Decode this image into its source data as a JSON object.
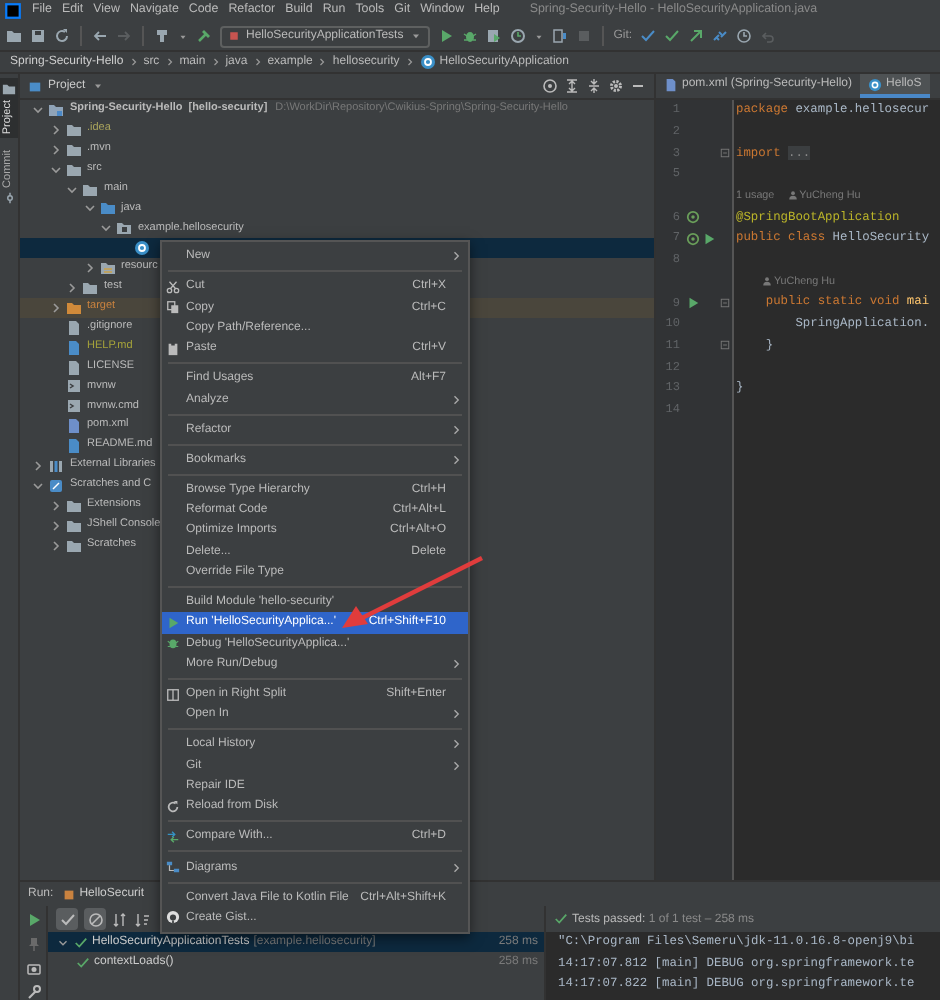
{
  "menu_bar": {
    "items": [
      "File",
      "Edit",
      "View",
      "Navigate",
      "Code",
      "Refactor",
      "Build",
      "Run",
      "Tools",
      "Git",
      "Window",
      "Help"
    ],
    "title": "Spring-Security-Hello - HelloSecurityApplication.java"
  },
  "toolbar": {
    "run_config": "HelloSecurityApplicationTests",
    "git_label": "Git:"
  },
  "breadcrumb": [
    "Spring-Security-Hello",
    "src",
    "main",
    "java",
    "example",
    "hellosecurity",
    "HelloSecurityApplication"
  ],
  "side_tabs": [
    {
      "label": "Project",
      "selected": true
    },
    {
      "label": "Commit",
      "selected": false
    }
  ],
  "project_panel": {
    "title": "Project",
    "tree": [
      {
        "label": "Spring-Security-Hello",
        "suffix": "[hello-security]",
        "path": "D:\\WorkDir\\Repository\\Cwikius-Spring\\Spring-Security-Hello",
        "kind": "module",
        "expanded": true,
        "selected": false,
        "children": [
          {
            "label": ".idea",
            "kind": "folder",
            "expanded": false,
            "selected": false,
            "color": "#a8a25c"
          },
          {
            "label": ".mvn",
            "kind": "folder",
            "expanded": false,
            "selected": false
          },
          {
            "label": "src",
            "kind": "folder",
            "expanded": true,
            "selected": false,
            "children": [
              {
                "label": "main",
                "kind": "folder",
                "expanded": true,
                "selected": false,
                "children": [
                  {
                    "label": "java",
                    "kind": "source",
                    "expanded": true,
                    "selected": false,
                    "children": [
                      {
                        "label": "example.hellosecurity",
                        "kind": "package",
                        "expanded": true,
                        "selected": false,
                        "children": [
                          {
                            "kind": "class",
                            "selected": true
                          }
                        ]
                      }
                    ]
                  },
                  {
                    "label": "resourc",
                    "kind": "resources",
                    "expanded": false,
                    "selected": false
                  }
                ]
              },
              {
                "label": "test",
                "kind": "folder",
                "expanded": false,
                "selected": false
              }
            ]
          },
          {
            "label": "target",
            "kind": "excluded",
            "expanded": false,
            "selected": false,
            "color": "#c9823f"
          },
          {
            "label": ".gitignore",
            "kind": "file",
            "selected": false
          },
          {
            "label": "HELP.md",
            "kind": "markdown",
            "selected": false,
            "color": "#a6a33a"
          },
          {
            "label": "LICENSE",
            "kind": "file",
            "selected": false
          },
          {
            "label": "mvnw",
            "kind": "script",
            "selected": false
          },
          {
            "label": "mvnw.cmd",
            "kind": "script",
            "selected": false
          },
          {
            "label": "pom.xml",
            "kind": "maven",
            "selected": false
          },
          {
            "label": "README.md",
            "kind": "markdown",
            "selected": false
          }
        ]
      },
      {
        "label": "External Libraries",
        "kind": "libraries",
        "expanded": false,
        "selected": false
      },
      {
        "label": "Scratches and C",
        "kind": "scratches",
        "expanded": true,
        "selected": false,
        "children": [
          {
            "label": "Extensions",
            "kind": "folder",
            "expanded": false,
            "selected": false
          },
          {
            "label": "JShell Console",
            "kind": "folder",
            "expanded": false,
            "selected": false
          },
          {
            "label": "Scratches",
            "kind": "folder",
            "expanded": false,
            "selected": false
          }
        ]
      }
    ]
  },
  "editor": {
    "tabs": [
      {
        "label": "pom.xml (Spring-Security-Hello)",
        "kind": "maven",
        "selected": false
      },
      {
        "label": "HelloS",
        "kind": "class",
        "selected": true
      }
    ],
    "lines": [
      {
        "number": "1",
        "tokens": [
          {
            "text": "package",
            "kind": "keyword"
          },
          {
            "text": " example.hellosecur",
            "kind": "plain"
          }
        ]
      },
      {
        "number": "2"
      },
      {
        "number": "3",
        "fold": true,
        "tokens": [
          {
            "text": "import ",
            "kind": "keyword"
          },
          {
            "text": "...",
            "kind": "folded"
          }
        ]
      },
      {
        "number": "5"
      },
      {
        "kind": "hint",
        "usages": "1 usage",
        "author": "YuCheng Hu"
      },
      {
        "number": "6",
        "bean": true,
        "tokens": [
          {
            "text": "@SpringBootApplication",
            "kind": "annotation"
          }
        ]
      },
      {
        "number": "7",
        "bean": true,
        "runnable": true,
        "tokens": [
          {
            "text": "public class",
            "kind": "keyword"
          },
          {
            "text": " HelloSecurity",
            "kind": "plain"
          }
        ]
      },
      {
        "number": "8"
      },
      {
        "kind": "hint",
        "author": "YuCheng Hu"
      },
      {
        "number": "9",
        "runnable": true,
        "fold": true,
        "tokens": [
          {
            "text": "    public static void",
            "kind": "keyword"
          },
          {
            "text": " mai",
            "kind": "method"
          }
        ]
      },
      {
        "number": "10",
        "tokens": [
          {
            "text": "        SpringApplication.",
            "kind": "plain"
          }
        ]
      },
      {
        "number": "11",
        "fold": true,
        "tokens": [
          {
            "text": "    }",
            "kind": "plain"
          }
        ]
      },
      {
        "number": "12"
      },
      {
        "number": "13",
        "tokens": [
          {
            "text": "}",
            "kind": "plain"
          }
        ]
      },
      {
        "number": "14"
      }
    ]
  },
  "context_menu": {
    "groups": [
      [
        {
          "label": "New",
          "submenu": true,
          "selected": false
        }
      ],
      [
        {
          "label": "Cut",
          "shortcut": "Ctrl+X",
          "submenu": false,
          "selected": false
        },
        {
          "label": "Copy",
          "shortcut": "Ctrl+C",
          "submenu": false,
          "selected": false
        },
        {
          "label": "Copy Path/Reference...",
          "submenu": false,
          "selected": false
        },
        {
          "label": "Paste",
          "shortcut": "Ctrl+V",
          "submenu": false,
          "selected": false
        }
      ],
      [
        {
          "label": "Find Usages",
          "shortcut": "Alt+F7",
          "submenu": false,
          "selected": false
        },
        {
          "label": "Analyze",
          "submenu": true,
          "selected": false
        }
      ],
      [
        {
          "label": "Refactor",
          "submenu": true,
          "selected": false
        }
      ],
      [
        {
          "label": "Bookmarks",
          "submenu": true,
          "selected": false
        }
      ],
      [
        {
          "label": "Browse Type Hierarchy",
          "shortcut": "Ctrl+H",
          "submenu": false,
          "selected": false
        },
        {
          "label": "Reformat Code",
          "shortcut": "Ctrl+Alt+L",
          "submenu": false,
          "selected": false
        },
        {
          "label": "Optimize Imports",
          "shortcut": "Ctrl+Alt+O",
          "submenu": false,
          "selected": false
        },
        {
          "label": "Delete...",
          "shortcut": "Delete",
          "submenu": false,
          "selected": false
        },
        {
          "label": "Override File Type",
          "submenu": false,
          "selected": false
        }
      ],
      [
        {
          "label": "Build Module 'hello-security'",
          "submenu": false,
          "selected": false
        },
        {
          "label": "Run 'HelloSecurityApplica...'",
          "shortcut": "Ctrl+Shift+F10",
          "submenu": false,
          "selected": true
        },
        {
          "label": "Debug 'HelloSecurityApplica...'",
          "submenu": false,
          "selected": false
        },
        {
          "label": "More Run/Debug",
          "submenu": true,
          "selected": false
        }
      ],
      [
        {
          "label": "Open in Right Split",
          "shortcut": "Shift+Enter",
          "submenu": false,
          "selected": false
        },
        {
          "label": "Open In",
          "submenu": true,
          "selected": false
        }
      ],
      [
        {
          "label": "Local History",
          "submenu": true,
          "selected": false
        },
        {
          "label": "Git",
          "submenu": true,
          "selected": false
        },
        {
          "label": "Repair IDE",
          "submenu": false,
          "selected": false
        },
        {
          "label": "Reload from Disk",
          "submenu": false,
          "selected": false
        }
      ],
      [
        {
          "label": "Compare With...",
          "shortcut": "Ctrl+D",
          "submenu": false,
          "selected": false
        }
      ],
      [
        {
          "label": "Diagrams",
          "submenu": true,
          "selected": false
        }
      ],
      [
        {
          "label": "Convert Java File to Kotlin File",
          "shortcut": "Ctrl+Alt+Shift+K",
          "submenu": false,
          "selected": false
        },
        {
          "label": "Create Gist...",
          "submenu": false,
          "selected": false
        }
      ]
    ]
  },
  "run_panel": {
    "label": "Run:",
    "tab": "HelloSecurit",
    "toggles": [
      {
        "selected": true
      },
      {
        "selected": true
      }
    ],
    "tests": [
      {
        "label": "HelloSecurityApplicationTests",
        "detail": "[example.hellosecurity]",
        "time": "258 ms",
        "expanded": true,
        "selected": true,
        "children": [
          {
            "label": "contextLoads()",
            "time": "258 ms",
            "selected": false
          }
        ]
      }
    ],
    "status": "**Tests passed:** 1 of 1 test – 258 ms",
    "console": [
      "\"C:\\Program Files\\Semeru\\jdk-11.0.16.8-openj9\\bi",
      "14:17:07.812 [main] DEBUG org.springframework.te",
      "14:17:07.822 [main] DEBUG org.springframework.te"
    ]
  }
}
